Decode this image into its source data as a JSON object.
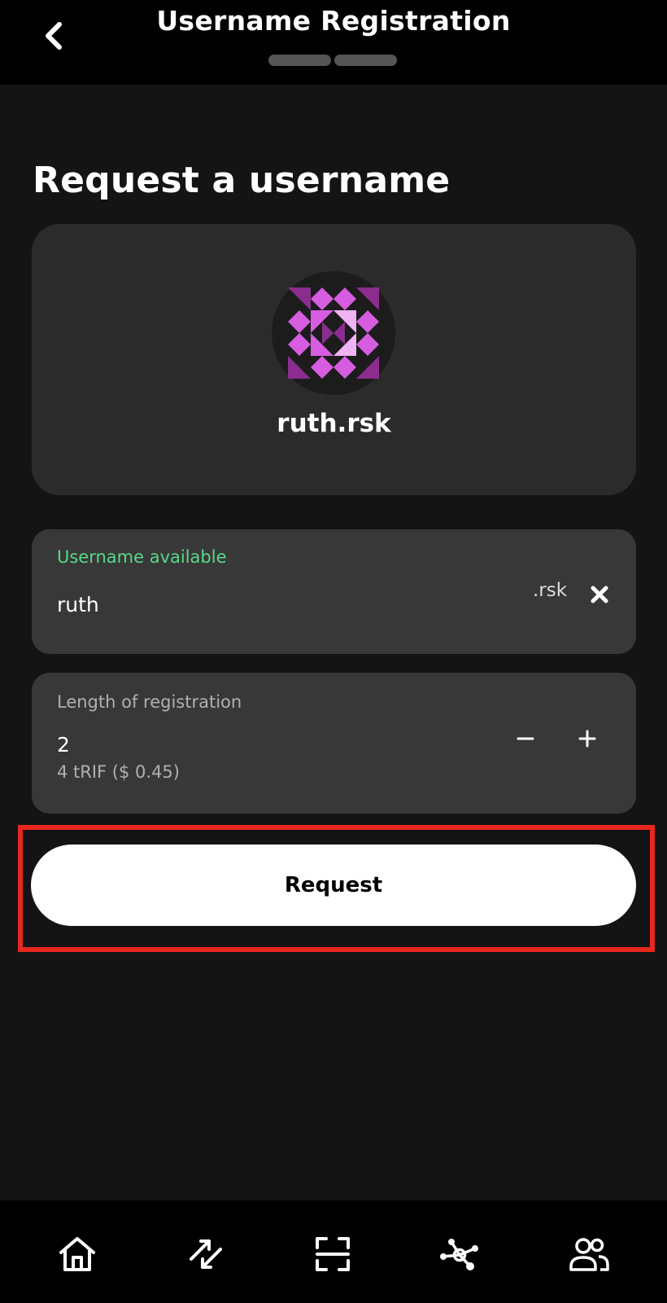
{
  "header": {
    "title": "Username Registration",
    "back_icon": "chevron-left-icon",
    "progress_steps": 2
  },
  "page": {
    "title": "Request a username"
  },
  "profile": {
    "avatar_icon": "identicon-avatar",
    "name": "ruth.rsk"
  },
  "username_field": {
    "status": "Username available",
    "value": "ruth",
    "suffix": ".rsk",
    "clear_icon": "close-icon"
  },
  "length_field": {
    "label": "Length of registration",
    "value": "2",
    "price": "4 tRIF ($ 0.45)",
    "decrement_icon": "minus-icon",
    "increment_icon": "plus-icon"
  },
  "request_button": {
    "label": "Request"
  },
  "bottom_nav": {
    "items": [
      "home-icon",
      "transfer-icon",
      "scan-icon",
      "network-icon",
      "contacts-icon"
    ]
  },
  "colors": {
    "background": "#141414",
    "header": "#000000",
    "card": "#2b2b2b",
    "field": "#383838",
    "success": "#59d988",
    "highlight": "#e8281e",
    "avatar_primary": "#d65de0",
    "avatar_dark": "#8a2d8e",
    "avatar_light": "#efb3f2"
  }
}
